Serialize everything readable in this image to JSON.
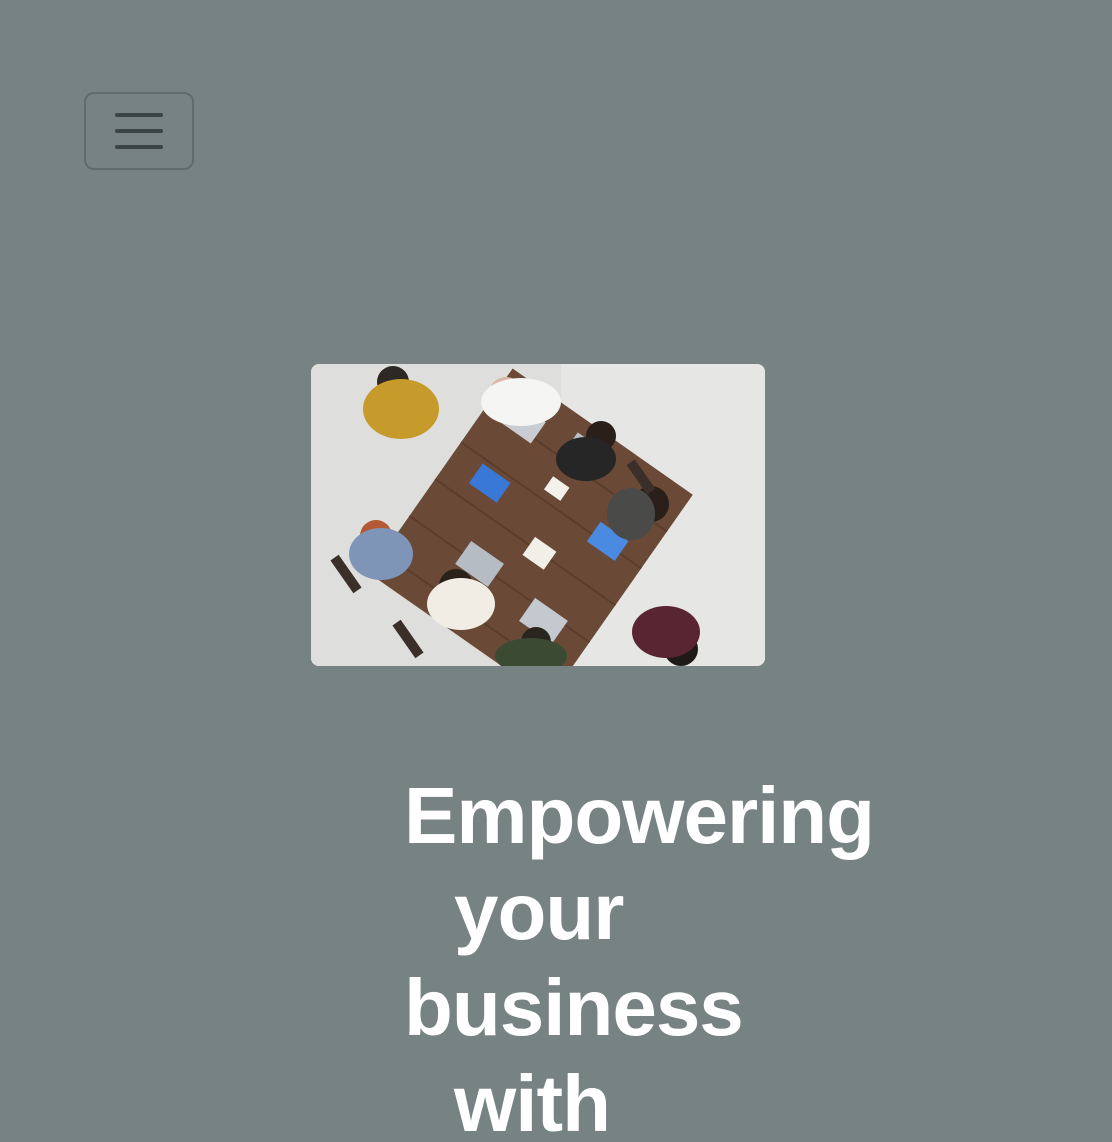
{
  "nav": {
    "menu_icon": "hamburger-menu-icon"
  },
  "hero": {
    "image_icon": "team-meeting-photo",
    "headline_lines": [
      "Empowering",
      "your",
      "business",
      "with"
    ]
  },
  "colors": {
    "background": "#778282",
    "headline": "#ffffff",
    "menu_border": "#626b6b",
    "menu_icon": "#3b4444"
  }
}
